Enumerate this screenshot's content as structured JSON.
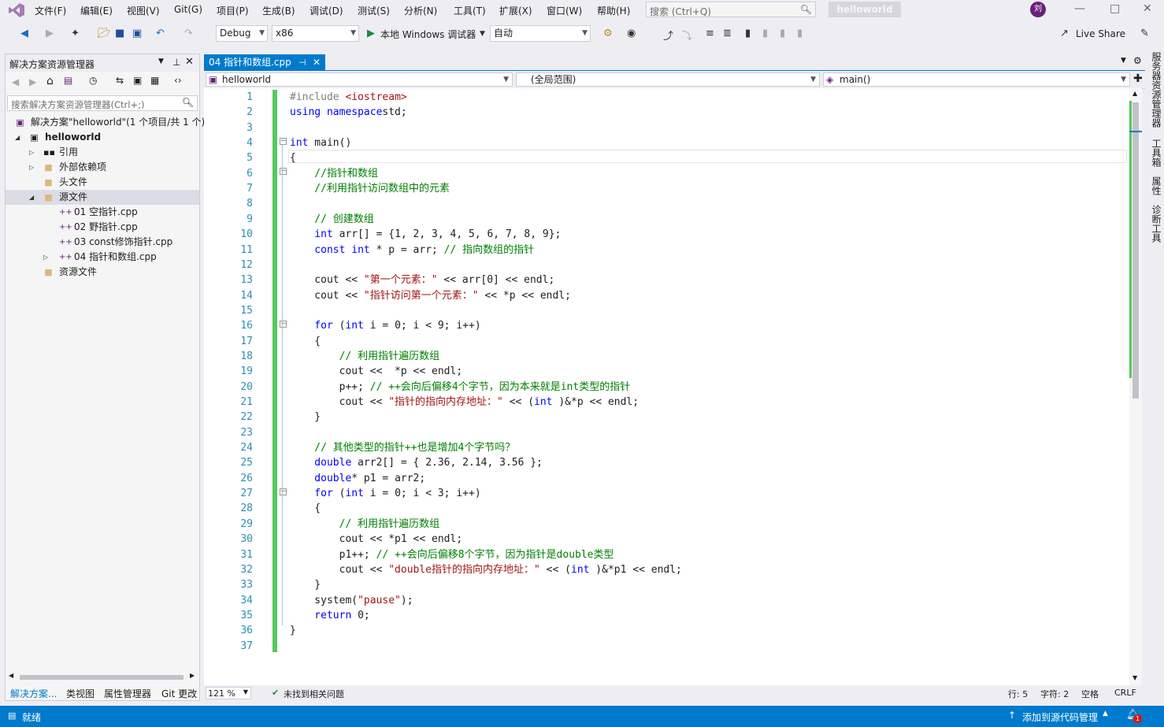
{
  "menu": {
    "items": [
      "文件(F)",
      "编辑(E)",
      "视图(V)",
      "Git(G)",
      "项目(P)",
      "生成(B)",
      "调试(D)",
      "测试(S)",
      "分析(N)",
      "工具(T)",
      "扩展(X)",
      "窗口(W)",
      "帮助(H)"
    ],
    "search_placeholder": "搜索 (Ctrl+Q)",
    "project_title": "helloworld",
    "avatar_initials": "刘"
  },
  "toolbar": {
    "config": "Debug",
    "platform": "x86",
    "run_label": "本地 Windows 调试器",
    "run_mode": "自动",
    "live_share": "Live Share"
  },
  "solution_explorer": {
    "title": "解决方案资源管理器",
    "search_placeholder": "搜索解决方案资源管理器(Ctrl+;)",
    "tree": [
      {
        "label": "解决方案\"helloworld\"(1 个项目/共 1 个)",
        "icon": "solution-icon"
      },
      {
        "label": "helloworld",
        "icon": "project-icon"
      },
      {
        "label": "引用",
        "icon": "references-icon"
      },
      {
        "label": "外部依赖项",
        "icon": "folder-icon"
      },
      {
        "label": "头文件",
        "icon": "folder-icon"
      },
      {
        "label": "源文件",
        "icon": "folder-icon"
      },
      {
        "label": "01 空指针.cpp",
        "icon": "cpp-file-icon"
      },
      {
        "label": "02 野指针.cpp",
        "icon": "cpp-file-icon"
      },
      {
        "label": "03 const修饰指针.cpp",
        "icon": "cpp-file-icon"
      },
      {
        "label": "04 指针和数组.cpp",
        "icon": "cpp-file-icon"
      },
      {
        "label": "资源文件",
        "icon": "folder-icon"
      }
    ],
    "tabs": [
      "解决方案...",
      "类视图",
      "属性管理器",
      "Git 更改"
    ]
  },
  "editor": {
    "tab_label": "04 指针和数组.cpp",
    "nav_project": "helloworld",
    "nav_scope": "(全局范围)",
    "nav_member": "main()",
    "line_numbers": [
      "1",
      "2",
      "3",
      "4",
      "5",
      "6",
      "7",
      "8",
      "9",
      "10",
      "11",
      "12",
      "13",
      "14",
      "15",
      "16",
      "17",
      "18",
      "19",
      "20",
      "21",
      "22",
      "23",
      "24",
      "25",
      "26",
      "27",
      "28",
      "29",
      "30",
      "31",
      "32",
      "33",
      "34",
      "35",
      "36",
      "37"
    ],
    "zoom": "121 %",
    "issues": "未找到相关问题",
    "line_col": "行: 5",
    "char_col": "字符: 2",
    "spacing": "空格",
    "line_ending": "CRLF"
  },
  "code_lines": [
    [
      [
        "pp",
        "#include "
      ],
      [
        "inc",
        "<iostream>"
      ]
    ],
    [
      [
        "kw",
        "using namespace"
      ],
      [
        "",
        "std;"
      ]
    ],
    [],
    [
      [
        "kw",
        "int"
      ],
      [
        "",
        " main()"
      ]
    ],
    [
      [
        "",
        "{"
      ]
    ],
    [
      [
        "cm",
        "    //指针和数组"
      ]
    ],
    [
      [
        "cm",
        "    //利用指针访问数组中的元素"
      ]
    ],
    [],
    [
      [
        "cm",
        "    // 创建数组"
      ]
    ],
    [
      [
        "kw",
        "    int"
      ],
      [
        "",
        " arr[] = {1, 2, 3, 4, 5, 6, 7, 8, 9};"
      ]
    ],
    [
      [
        "kw",
        "    const int"
      ],
      [
        "",
        " * p = arr; "
      ],
      [
        "cm",
        "// 指向数组的指针"
      ]
    ],
    [],
    [
      [
        "",
        "    cout << "
      ],
      [
        "st",
        "\"第一个元素：\""
      ],
      [
        "",
        " << arr[0] << endl;"
      ]
    ],
    [
      [
        "",
        "    cout << "
      ],
      [
        "st",
        "\"指针访问第一个元素：\""
      ],
      [
        "",
        " << *p << endl;"
      ]
    ],
    [],
    [
      [
        "kw",
        "    for"
      ],
      [
        "",
        " ("
      ],
      [
        "kw",
        "int"
      ],
      [
        "",
        " i = 0; i < 9; i++)"
      ]
    ],
    [
      [
        "",
        "    {"
      ]
    ],
    [
      [
        "cm",
        "        // 利用指针遍历数组"
      ]
    ],
    [
      [
        "",
        "        cout <<  *p << endl;"
      ]
    ],
    [
      [
        "",
        "        p++; "
      ],
      [
        "cm",
        "// ++会向后偏移4个字节，因为本来就是int类型的指针"
      ]
    ],
    [
      [
        "",
        "        cout << "
      ],
      [
        "st",
        "\"指针的指向内存地址：\""
      ],
      [
        "",
        " << ("
      ],
      [
        "kw",
        "int"
      ],
      [
        "",
        " )&*p << endl;"
      ]
    ],
    [
      [
        "",
        "    }"
      ]
    ],
    [],
    [
      [
        "cm",
        "    // 其他类型的指针++也是增加4个字节吗？"
      ]
    ],
    [
      [
        "kw",
        "    double"
      ],
      [
        "",
        " arr2[] = { 2.36, 2.14, 3.56 };"
      ]
    ],
    [
      [
        "kw",
        "    double"
      ],
      [
        "",
        "* p1 = arr2;"
      ]
    ],
    [
      [
        "kw",
        "    for"
      ],
      [
        "",
        " ("
      ],
      [
        "kw",
        "int"
      ],
      [
        "",
        " i = 0; i < 3; i++)"
      ]
    ],
    [
      [
        "",
        "    {"
      ]
    ],
    [
      [
        "cm",
        "        // 利用指针遍历数组"
      ]
    ],
    [
      [
        "",
        "        cout << *p1 << endl;"
      ]
    ],
    [
      [
        "",
        "        p1++; "
      ],
      [
        "cm",
        "// ++会向后偏移8个字节，因为指针是double类型"
      ]
    ],
    [
      [
        "",
        "        cout << "
      ],
      [
        "st",
        "\"double指针的指向内存地址：\""
      ],
      [
        "",
        " << ("
      ],
      [
        "kw",
        "int"
      ],
      [
        "",
        " )&*p1 << endl;"
      ]
    ],
    [
      [
        "",
        "    }"
      ]
    ],
    [
      [
        "",
        "    system("
      ],
      [
        "st",
        "\"pause\""
      ],
      [
        "",
        ");"
      ]
    ],
    [
      [
        "kw",
        "    return"
      ],
      [
        "",
        " 0;"
      ]
    ],
    [
      [
        "",
        "}"
      ]
    ],
    []
  ],
  "right_tabs": [
    "服务器资源管理器",
    "工具箱",
    "属性",
    "诊断工具"
  ],
  "statusbar": {
    "ready": "就绪",
    "source_control": "添加到源代码管理",
    "notifications": "1"
  },
  "colors": {
    "accent": "#007acc",
    "change_bar": "#57c85d",
    "keyword": "#0000ff",
    "comment": "#008000",
    "string": "#a31515"
  }
}
